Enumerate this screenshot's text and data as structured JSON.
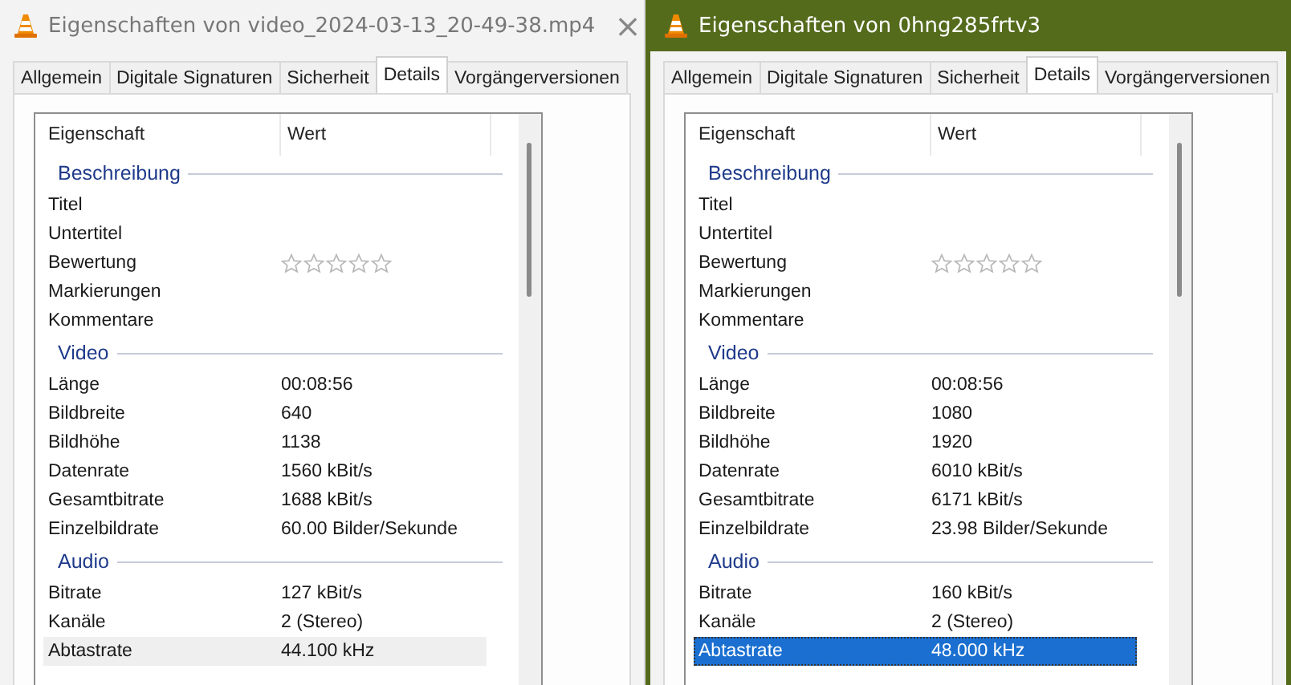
{
  "windows": [
    {
      "title": "Eigenschaften von video_2024-03-13_20-49-38.mp4",
      "active": false,
      "close_button": "×",
      "tabs": [
        {
          "label": "Allgemein",
          "selected": false
        },
        {
          "label": "Digitale Signaturen",
          "selected": false
        },
        {
          "label": "Sicherheit",
          "selected": false
        },
        {
          "label": "Details",
          "selected": true
        },
        {
          "label": "Vorgängerversionen",
          "selected": false
        }
      ],
      "columns": [
        "Eigenschaft",
        "Wert"
      ],
      "sections": [
        {
          "title": "Beschreibung",
          "rows": [
            {
              "kind": "text",
              "name": "Titel",
              "value": "",
              "selected": false
            },
            {
              "kind": "text",
              "name": "Untertitel",
              "value": "",
              "selected": false
            },
            {
              "kind": "rating",
              "name": "Bewertung",
              "stars": 0,
              "selected": false
            },
            {
              "kind": "text",
              "name": "Markierungen",
              "value": "",
              "selected": false
            },
            {
              "kind": "text",
              "name": "Kommentare",
              "value": "",
              "selected": false
            }
          ]
        },
        {
          "title": "Video",
          "rows": [
            {
              "kind": "text",
              "name": "Länge",
              "value": "00:08:56",
              "selected": false
            },
            {
              "kind": "text",
              "name": "Bildbreite",
              "value": "640",
              "selected": false
            },
            {
              "kind": "text",
              "name": "Bildhöhe",
              "value": "1138",
              "selected": false
            },
            {
              "kind": "text",
              "name": "Datenrate",
              "value": "1560 kBit/s",
              "selected": false
            },
            {
              "kind": "text",
              "name": "Gesamtbitrate",
              "value": "1688 kBit/s",
              "selected": false
            },
            {
              "kind": "text",
              "name": "Einzelbildrate",
              "value": "60.00 Bilder/Sekunde",
              "selected": false
            }
          ]
        },
        {
          "title": "Audio",
          "rows": [
            {
              "kind": "text",
              "name": "Bitrate",
              "value": "127 kBit/s",
              "selected": false
            },
            {
              "kind": "text",
              "name": "Kanäle",
              "value": "2 (Stereo)",
              "selected": false
            },
            {
              "kind": "text",
              "name": "Abtastrate",
              "value": "44.100 kHz",
              "selected": true
            }
          ]
        }
      ]
    },
    {
      "title": "Eigenschaften von 0hng285frtv3",
      "active": true,
      "tabs": [
        {
          "label": "Allgemein",
          "selected": false
        },
        {
          "label": "Digitale Signaturen",
          "selected": false
        },
        {
          "label": "Sicherheit",
          "selected": false
        },
        {
          "label": "Details",
          "selected": true
        },
        {
          "label": "Vorgängerversionen",
          "selected": false
        }
      ],
      "columns": [
        "Eigenschaft",
        "Wert"
      ],
      "sections": [
        {
          "title": "Beschreibung",
          "rows": [
            {
              "kind": "text",
              "name": "Titel",
              "value": "",
              "selected": false
            },
            {
              "kind": "text",
              "name": "Untertitel",
              "value": "",
              "selected": false
            },
            {
              "kind": "rating",
              "name": "Bewertung",
              "stars": 0,
              "selected": false
            },
            {
              "kind": "text",
              "name": "Markierungen",
              "value": "",
              "selected": false
            },
            {
              "kind": "text",
              "name": "Kommentare",
              "value": "",
              "selected": false
            }
          ]
        },
        {
          "title": "Video",
          "rows": [
            {
              "kind": "text",
              "name": "Länge",
              "value": "00:08:56",
              "selected": false
            },
            {
              "kind": "text",
              "name": "Bildbreite",
              "value": "1080",
              "selected": false
            },
            {
              "kind": "text",
              "name": "Bildhöhe",
              "value": "1920",
              "selected": false
            },
            {
              "kind": "text",
              "name": "Datenrate",
              "value": "6010 kBit/s",
              "selected": false
            },
            {
              "kind": "text",
              "name": "Gesamtbitrate",
              "value": "6171 kBit/s",
              "selected": false
            },
            {
              "kind": "text",
              "name": "Einzelbildrate",
              "value": "23.98 Bilder/Sekunde",
              "selected": false
            }
          ]
        },
        {
          "title": "Audio",
          "rows": [
            {
              "kind": "text",
              "name": "Bitrate",
              "value": "160 kBit/s",
              "selected": false
            },
            {
              "kind": "text",
              "name": "Kanäle",
              "value": "2 (Stereo)",
              "selected": false
            },
            {
              "kind": "text",
              "name": "Abtastrate",
              "value": "48.000 kHz",
              "selected": true
            }
          ]
        }
      ]
    }
  ]
}
